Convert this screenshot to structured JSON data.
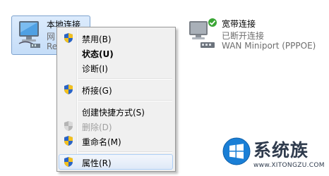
{
  "local_connection": {
    "name": "本地连接",
    "network_partial": "网",
    "device_partial": "Re",
    "icon": "network-adapter-icon"
  },
  "broadband_connection": {
    "name": "宽带连接",
    "status": "已断开连接",
    "device": "WAN Miniport (PPPOE)",
    "icon": "network-adapter-icon",
    "badge_icon": "check-icon"
  },
  "context_menu": {
    "items": [
      {
        "label": "禁用(B)",
        "icon": "uac-shield-icon"
      },
      {
        "label": "状态(U)",
        "bold": true
      },
      {
        "label": "诊断(I)"
      },
      {
        "label": "桥接(G)",
        "icon": "uac-shield-icon"
      },
      {
        "label": "创建快捷方式(S)"
      },
      {
        "label": "删除(D)",
        "icon": "uac-shield-icon",
        "disabled": true
      },
      {
        "label": "重命名(M)",
        "icon": "uac-shield-icon"
      },
      {
        "label": "属性(R)",
        "icon": "uac-shield-icon",
        "highlighted": true
      }
    ]
  },
  "watermark": {
    "title": "系统族",
    "url": "www.XITONGZU.COM",
    "icon": "windows-logo-icon"
  },
  "colors": {
    "selection_bg": "#c5ddf8",
    "menu_bg": "#f0f0f0",
    "shield_blue": "#2a64c5",
    "shield_yellow": "#f2c01e",
    "check_green": "#3aa635",
    "logo_blue": "#1a7fd6"
  }
}
